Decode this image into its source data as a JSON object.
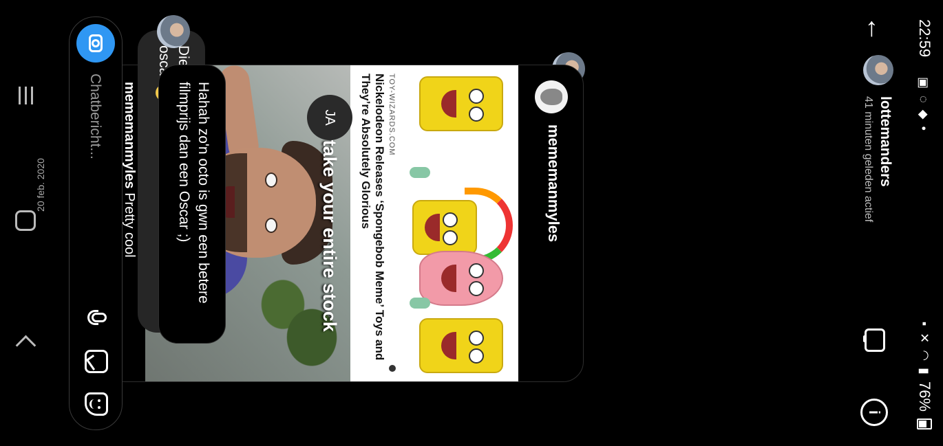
{
  "status_bar": {
    "time": "22:59",
    "battery": "76%"
  },
  "header": {
    "name": "lottemanders",
    "status": "41 minuten geleden actief"
  },
  "shared_post": {
    "owner": "mememanmyles",
    "source": "TOY-WIZARDS.COM",
    "headline": "Nickelodeon Releases ‘Spongebob Meme’ Toys and They’re Absolutely Glorious",
    "meme_caption": "I'll take your entire stock",
    "caption_user": "mememanmyles",
    "caption_text": "Pretty cool"
  },
  "messages": {
    "reply_badge": "JA",
    "mine_text": "Die knappe octo lijkt een beetje op een oscar",
    "mine_emoji": "🤔",
    "timestamp": "20 feb. 2020",
    "theirs_text": "Hahah zo'n octo is gwn een betere filmprijs dan een Oscar ;)"
  },
  "composer": {
    "placeholder": "Chatbericht..."
  },
  "colors": {
    "accent": "#2f97f3",
    "bubble": "#262626",
    "background": "#000000"
  }
}
